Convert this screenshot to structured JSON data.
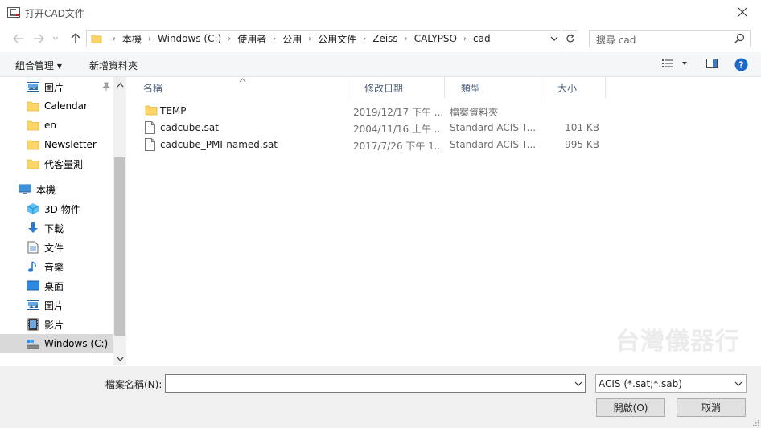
{
  "window": {
    "title": "打开CAD文件",
    "close_glyph": "✕"
  },
  "address_bar": {
    "back_glyph": "←",
    "forward_glyph": "→",
    "recent_glyph": "⌄",
    "up_glyph": "↑",
    "crumbs": [
      "本機",
      "Windows (C:)",
      "使用者",
      "公用",
      "公用文件",
      "Zeiss",
      "CALYPSO",
      "cad"
    ],
    "separator": "›",
    "search_placeholder": "搜尋 cad"
  },
  "toolbar": {
    "organize_label": "組合管理 ▾",
    "new_folder_label": "新增資料夾"
  },
  "nav_pane": {
    "quick_items": [
      {
        "label": "圖片",
        "icon": "pictures-icon",
        "pinned": true
      },
      {
        "label": "Calendar",
        "icon": "folder-icon"
      },
      {
        "label": "en",
        "icon": "folder-icon"
      },
      {
        "label": "Newsletter",
        "icon": "folder-icon"
      },
      {
        "label": "代客量測",
        "icon": "folder-icon"
      }
    ],
    "this_pc_label": "本機",
    "pc_items": [
      {
        "label": "3D 物件",
        "icon": "3d-objects-icon"
      },
      {
        "label": "下載",
        "icon": "downloads-icon"
      },
      {
        "label": "文件",
        "icon": "documents-icon"
      },
      {
        "label": "音樂",
        "icon": "music-icon"
      },
      {
        "label": "桌面",
        "icon": "desktop-icon"
      },
      {
        "label": "圖片",
        "icon": "pictures-icon"
      },
      {
        "label": "影片",
        "icon": "videos-icon"
      },
      {
        "label": "Windows (C:)",
        "icon": "drive-icon",
        "selected": true
      }
    ]
  },
  "file_list": {
    "columns": [
      "名稱",
      "修改日期",
      "類型",
      "大小"
    ],
    "rows": [
      {
        "name": "TEMP",
        "icon": "folder-icon",
        "modified": "2019/12/17 下午 ...",
        "type": "檔案資料夾",
        "size": ""
      },
      {
        "name": "cadcube.sat",
        "icon": "file-icon",
        "modified": "2004/11/16 上午 ...",
        "type": "Standard ACIS T...",
        "size": "101 KB"
      },
      {
        "name": "cadcube_PMI-named.sat",
        "icon": "file-icon",
        "modified": "2017/7/26 下午 1...",
        "type": "Standard ACIS T...",
        "size": "995 KB"
      }
    ]
  },
  "watermark": "台灣儀器行",
  "bottom": {
    "filename_label": "檔案名稱(N):",
    "filename_value": "",
    "filter_value": "ACIS (*.sat;*.sab)",
    "open_label": "開啟(O)",
    "cancel_label": "取消"
  }
}
